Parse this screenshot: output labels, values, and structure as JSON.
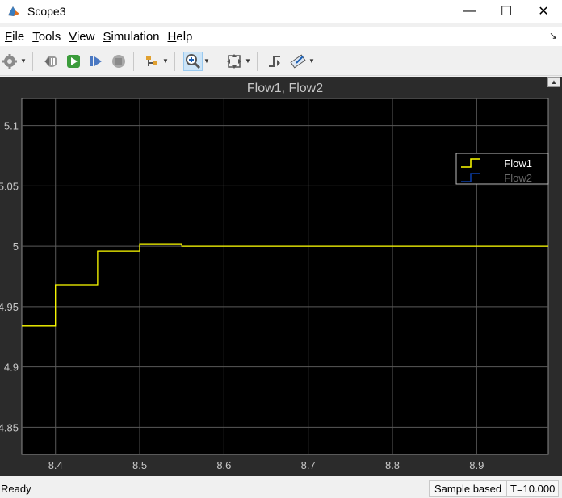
{
  "window": {
    "title": "Scope3",
    "controls": {
      "minimize": "—",
      "maximize": "☐",
      "close": "✕"
    }
  },
  "menu": {
    "items": [
      {
        "label": "File",
        "mnemonic": "F",
        "rest": "ile"
      },
      {
        "label": "Tools",
        "mnemonic": "T",
        "rest": "ools"
      },
      {
        "label": "View",
        "mnemonic": "V",
        "rest": "iew"
      },
      {
        "label": "Simulation",
        "mnemonic": "S",
        "rest": "imulation"
      },
      {
        "label": "Help",
        "mnemonic": "H",
        "rest": "elp"
      }
    ]
  },
  "toolbar": {
    "icons": [
      "settings-icon",
      "step-back-icon",
      "run-icon",
      "step-forward-icon",
      "stop-icon",
      "highlight-icon",
      "zoom-in-icon",
      "fit-to-view-icon",
      "triggers-icon",
      "measurements-icon"
    ],
    "active": "zoom-in-icon"
  },
  "colors": {
    "plot_bg": "#000000",
    "frame_bg": "#2b2b2b",
    "grid": "#5a5a5a",
    "axis_text": "#c8c8c8",
    "flow1": "#ffff00",
    "flow2": "#0b3da8",
    "status_bg": "#f0f0f0"
  },
  "chart_data": {
    "type": "line",
    "title": "Flow1, Flow2",
    "xlabel": "",
    "ylabel": "",
    "xlim": [
      8.36,
      8.985
    ],
    "ylim": [
      4.8275,
      5.1225
    ],
    "x_ticks": [
      "8.4",
      "8.5",
      "8.6",
      "8.7",
      "8.8",
      "8.9"
    ],
    "x_tick_values": [
      8.4,
      8.5,
      8.6,
      8.7,
      8.8,
      8.9
    ],
    "y_ticks": [
      "5.1",
      "5.05",
      "5",
      "4.95",
      "4.9",
      "4.85"
    ],
    "y_tick_values": [
      5.1,
      5.05,
      5.0,
      4.95,
      4.9,
      4.85
    ],
    "grid": true,
    "legend_position": "top-right",
    "series": [
      {
        "name": "Flow1",
        "step": true,
        "x": [
          8.36,
          8.4,
          8.45,
          8.5,
          8.55,
          8.985
        ],
        "y": [
          4.934,
          4.968,
          4.996,
          5.002,
          5.0,
          5.0
        ]
      },
      {
        "name": "Flow2",
        "step": true,
        "x": [],
        "y": []
      }
    ]
  },
  "status": {
    "text": "Ready",
    "mode": "Sample based",
    "time": "T=10.000"
  }
}
